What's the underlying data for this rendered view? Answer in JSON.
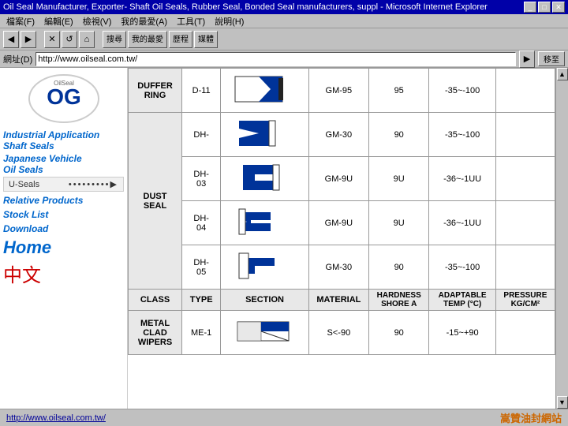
{
  "window": {
    "title": "Oil Seal Manufacturer, Exporter- Shaft Oil Seals, Rubber Seal, Bonded Seal manufacturers, suppl - Microsoft Internet Explorer",
    "buttons": [
      "_",
      "□",
      "✕"
    ]
  },
  "menubar": {
    "items": [
      "檔案(F)",
      "編輯(E)",
      "檢視(V)",
      "我的最愛(A)",
      "工具(T)",
      "說明(H)"
    ]
  },
  "toolbar": {
    "back": "←",
    "forward": "→",
    "stop": "✕",
    "refresh": "⟳",
    "home": "🏠",
    "search": "搜尋",
    "favorites": "我的最愛",
    "history": "歷程",
    "media": "媒體"
  },
  "addressbar": {
    "label": "網址(D)",
    "url": "http://www.oilseal.com.tw/",
    "go_label": "移至"
  },
  "sidebar": {
    "nav_links": [
      {
        "id": "industrial",
        "text": "Industrial Application\nShaft Seals"
      },
      {
        "id": "japanese",
        "text": "Japanese Vehicle\nOil Seals"
      }
    ],
    "useals_label": "U-Seals",
    "useals_dots": "•••••••••",
    "relative_label": "Relative Products",
    "stocklist_label": "Stock List",
    "download_label": "Download",
    "home_label": "Home",
    "chinese_label": "中文"
  },
  "product_table": {
    "headers": [
      "CLASS",
      "TYPE",
      "SECTION",
      "MATERIAL",
      "HARDNESS\nSHORE A",
      "ADAPTABLE\nTEMP (°C)",
      "PRESSURE\nKG/CM²"
    ],
    "categories": [
      {
        "name": "DUFFER\nRING",
        "rows": [
          {
            "type": "D-11",
            "material": "GM-95",
            "hardness": "95",
            "temp": "-35~-100"
          }
        ]
      },
      {
        "name": "DUST\nSEAL",
        "rows": [
          {
            "type": "DH-",
            "material": "GM-30",
            "hardness": "90",
            "temp": "-35~-100"
          },
          {
            "type": "DH-\n03",
            "material": "GM-9U",
            "hardness": "9U",
            "temp": "-36~-1UU"
          },
          {
            "type": "DH-\n04",
            "material": "GM-9U",
            "hardness": "9U",
            "temp": "-36~-1UU"
          },
          {
            "type": "DH-\n05",
            "material": "GM-30",
            "hardness": "90",
            "temp": "-35~-100"
          }
        ]
      },
      {
        "name": "CLASS",
        "rows": [
          {
            "type": "TYPE",
            "material": "MATERIAL",
            "hardness": "HARDNESS\nSHORE A",
            "section_header": "SECTION",
            "temp": "ADAPTABLE\nTEMP (°C)",
            "pressure_header": "PRESSURE\nKG/CM²"
          }
        ]
      },
      {
        "name": "METAL\nCLAD\nWIPERS",
        "rows": [
          {
            "type": "ME-1",
            "material": "S<-90",
            "hardness": "90",
            "temp": "-15~+90"
          }
        ]
      }
    ]
  },
  "statusbar": {
    "url": "http://www.oilseal.com.tw/",
    "brand": "嵩贊油封網站"
  },
  "colors": {
    "accent_blue": "#0000a8",
    "link_blue": "#0066cc",
    "red": "#cc0000",
    "seal_blue": "#003399",
    "bg_gray": "#c0c0c0"
  }
}
